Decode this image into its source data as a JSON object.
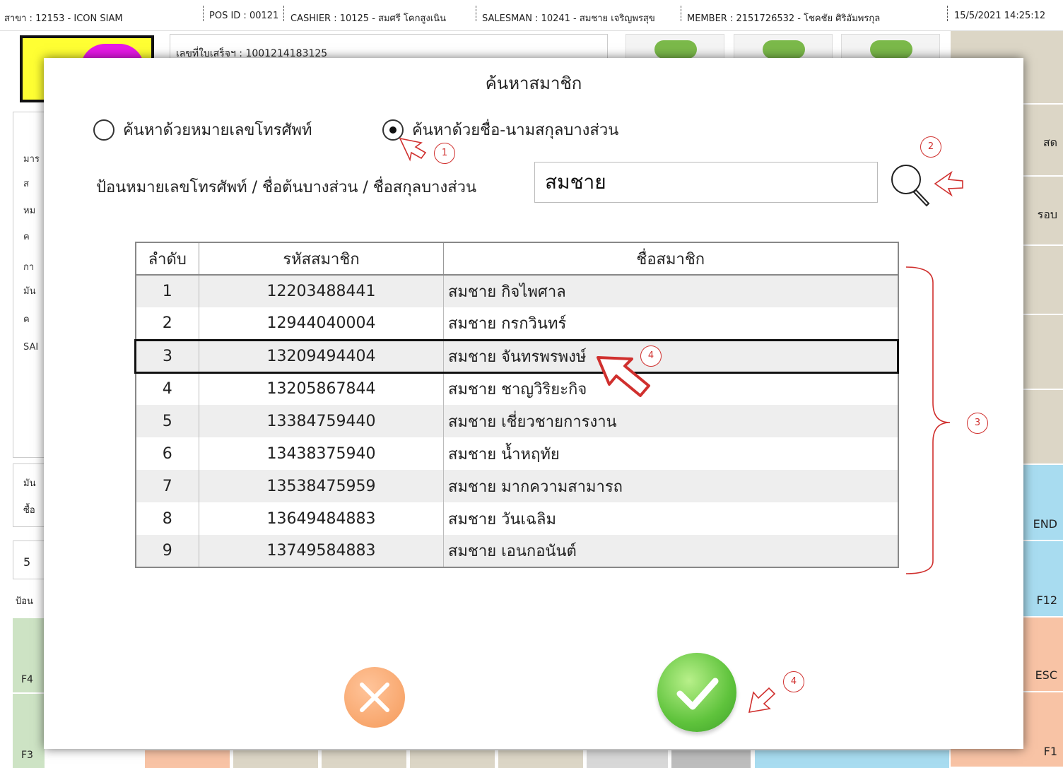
{
  "topbar": {
    "branch": "สาขา : 12153 - ICON SIAM",
    "pos_id": "POS ID : 00121",
    "cashier": "CASHIER : 10125 - สมศรี โคกสูงเนิน",
    "salesman": "SALESMAN : 10241 - สมชาย เจริญพรสุข",
    "member": "MEMBER : 2151726532 - โชคชัย ศิริอัมพรกุล",
    "datetime": "15/5/2021 14:25:12"
  },
  "background": {
    "receipt_label": "เลขที่ใบเสร็จฯ : 1001214183125",
    "left_labels": [
      "มาร",
      "ส",
      "หม",
      "ค",
      "กา",
      "มัน",
      "ค",
      "SAI"
    ],
    "left_box2": [
      "มัน",
      "ซื้อ"
    ],
    "left_box3": "5",
    "left_input_label": "ป้อน",
    "fkeys": [
      "F4",
      "F3"
    ],
    "right_labels": [
      "สด",
      "รอบ",
      "END",
      "F12",
      "ESC",
      "F1"
    ]
  },
  "dialog": {
    "title": "ค้นหาสมาชิก",
    "radio_phone_label": "ค้นหาด้วยหมายเลขโทรศัพท์",
    "radio_name_label": "ค้นหาด้วยชื่อ-นามสกุลบางส่วน",
    "selected_radio": "name",
    "input_label": "ป้อนหมายเลขโทรศัพท์ / ชื่อต้นบางส่วน / ชื่อสกุลบางส่วน",
    "search_value": "สมชาย",
    "table": {
      "headers": [
        "ลำดับ",
        "รหัสสมาชิก",
        "ชื่อสมาชิก"
      ],
      "rows": [
        {
          "no": "1",
          "id": "12203488441",
          "name": "สมชาย กิจไพศาล"
        },
        {
          "no": "2",
          "id": "12944040004",
          "name": "สมชาย กรกวินทร์"
        },
        {
          "no": "3",
          "id": "13209494404",
          "name": "สมชาย จันทรพรพงษ์"
        },
        {
          "no": "4",
          "id": "13205867844",
          "name": "สมชาย ชาญวิริยะกิจ"
        },
        {
          "no": "5",
          "id": "13384759440",
          "name": "สมชาย เชี่ยวชายการงาน"
        },
        {
          "no": "6",
          "id": "13438375940",
          "name": "สมชาย น้ำหฤทัย"
        },
        {
          "no": "7",
          "id": "13538475959",
          "name": "สมชาย มากความสามารถ"
        },
        {
          "no": "8",
          "id": "13649484883",
          "name": "สมชาย วันเฉลิม"
        },
        {
          "no": "9",
          "id": "13749584883",
          "name": "สมชาย เอนกอนันต์"
        }
      ],
      "selected_row": 3
    }
  },
  "annotations": {
    "step1": "1",
    "step2": "2",
    "step3": "3",
    "step4_row": "4",
    "step4_ok": "4",
    "color": "#d0302e"
  },
  "colors": {
    "ok_button": "#5fc33c",
    "cancel_button": "#f59a5a",
    "bg_green_key": "#cde3c4",
    "bg_blue_key": "#a8dcf0",
    "bg_orange_key": "#f8c3a5",
    "bg_tan_key": "#dcd6c6"
  },
  "icons": {
    "search": "magnifier-icon",
    "cancel": "x-icon",
    "ok": "check-icon",
    "pointer": "arrow-pointer-icon"
  }
}
